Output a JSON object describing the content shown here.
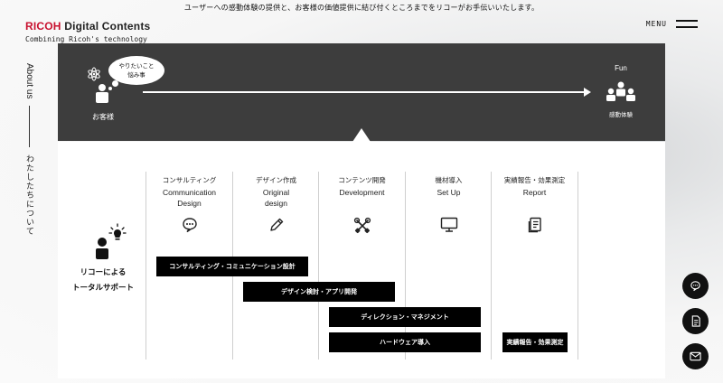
{
  "header": {
    "tagline": "ユーザーへの感動体験の提供と、お客様の価値提供に結び付くところまでをリコーがお手伝いいたします。",
    "logo_brand": "RICOH",
    "logo_rest": " Digital Contents",
    "logo_sub": "Combining Ricoh's technology",
    "menu_label": "MENU"
  },
  "side_nav": {
    "en": "About us",
    "jp": "わたしたちについて"
  },
  "flow": {
    "bubble_line1": "やりたいこと",
    "bubble_line2": "悩み事",
    "customer_label": "お客様",
    "fun_label": "Fun",
    "experience_label": "感動体験"
  },
  "columns": [
    {
      "jp": "コンサルティング",
      "en": "Communication Design",
      "icon": "chat-bubble-icon"
    },
    {
      "jp": "デザイン作成",
      "en": "Original design",
      "icon": "pencil-icon"
    },
    {
      "jp": "コンテンツ開発",
      "en": "Development",
      "icon": "tools-icon"
    },
    {
      "jp": "機材導入",
      "en": "Set Up",
      "icon": "monitor-icon"
    },
    {
      "jp": "実績報告・効果測定",
      "en": "Report",
      "icon": "report-document-icon"
    }
  ],
  "support": {
    "line1": "リコーによる",
    "line2": "トータルサポート"
  },
  "bars": [
    "コンサルティング・コミュニケーション設計",
    "デザイン検討・アプリ開発",
    "ディレクション・マネジメント",
    "ハードウェア導入",
    "実績報告・効果測定"
  ],
  "fabs": [
    "chat-icon",
    "document-icon",
    "mail-icon"
  ]
}
